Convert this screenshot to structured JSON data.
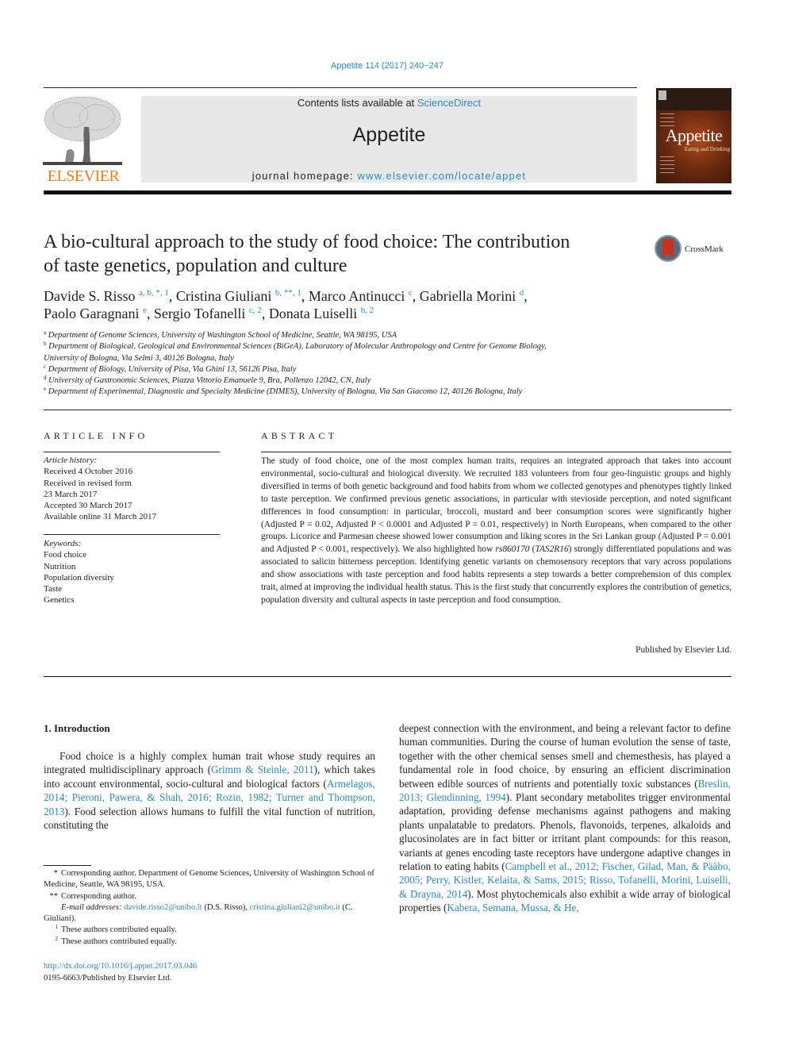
{
  "header": {
    "citation": "Appetite 114 (2017) 240−247",
    "contents_prefix": "Contents lists available at ",
    "contents_link": "ScienceDirect",
    "journal_name": "Appetite",
    "homepage_prefix": "journal homepage: ",
    "homepage_link": "www.elsevier.com/locate/appet",
    "publisher_logo": "ELSEVIER",
    "cover_title": "Appetite",
    "cover_subtitle": "Eating and Drinking",
    "colors": {
      "link": "#2a8ab8",
      "elsevier_orange": "#f07d1a",
      "masthead_gray": "#e8e8e8"
    }
  },
  "article": {
    "title_line1": "A bio-cultural approach to the study of food choice: The contribution",
    "title_line2": "of taste genetics, population and culture",
    "crossmark_label": "CrossMark",
    "authors": [
      {
        "name": "Davide S. Risso",
        "marks": "a, b, *, 1",
        "sep": ", "
      },
      {
        "name": "Cristina Giuliani",
        "marks": "b, **, 1",
        "sep": ", "
      },
      {
        "name": "Marco Antinucci",
        "marks": "c",
        "sep": ", "
      },
      {
        "name": "Gabriella Morini",
        "marks": "d",
        "sep": ","
      },
      {
        "name": "Paolo Garagnani",
        "marks": "e",
        "sep": ", "
      },
      {
        "name": "Sergio Tofanelli",
        "marks": "c, 2",
        "sep": ", "
      },
      {
        "name": "Donata Luiselli",
        "marks": "b, 2",
        "sep": ""
      }
    ],
    "affiliations": [
      {
        "mark": "a",
        "text": "Department of Genome Sciences, University of Washington School of Medicine, Seattle, WA 98195, USA"
      },
      {
        "mark": "b",
        "text": "Department of Biological, Geological and Environmental Sciences (BiGeA), Laboratory of Molecular Anthropology and Centre for Genome Biology,",
        "cont": "University of Bologna, Via Selmi 3, 40126 Bologna, Italy"
      },
      {
        "mark": "c",
        "text": "Department of Biology, University of Pisa, Via Ghini 13, 56126 Pisa, Italy"
      },
      {
        "mark": "d",
        "text": "University of Gastronomic Sciences, Piazza Vittorio Emanuele 9, Bra, Pollenzo 12042, CN, Italy"
      },
      {
        "mark": "e",
        "text": "Department of Experimental, Diagnostic and Specialty Medicine (DIMES), University of Bologna, Via San Giacomo 12, 40126 Bologna, Italy"
      }
    ]
  },
  "article_info": {
    "heading": "ARTICLE INFO",
    "history_label": "Article history:",
    "history": [
      "Received 4 October 2016",
      "Received in revised form",
      "23 March 2017",
      "Accepted 30 March 2017",
      "Available online 31 March 2017"
    ],
    "keywords_label": "Keywords:",
    "keywords": [
      "Food choice",
      "Nutrition",
      "Population diversity",
      "Taste",
      "Genetics"
    ]
  },
  "abstract": {
    "heading": "ABSTRACT",
    "part1": "The study of food choice, one of the most complex human traits, requires an integrated approach that takes into account environmental, socio-cultural and biological diversity. We recruited 183 volunteers from four geo-linguistic groups and highly diversified in terms of both genetic background and food habits from whom we collected genotypes and phenotypes tightly linked to taste perception. We confirmed previous genetic associations, in particular with stevioside perception, and noted significant differences in food consumption: in particular, broccoli, mustard and beer consumption scores were significantly higher (Adjusted P = 0.02, Adjusted P < 0.0001 and Adjusted P = 0.01, respectively) in North Europeans, when compared to the other groups. Licorice and Parmesan cheese showed lower consumption and liking scores in the Sri Lankan group (Adjusted P = 0.001 and Adjusted P < 0.001, respectively). We also highlighted how ",
    "snp": "rs860170",
    "paren_open": " (",
    "gene": "TAS2R16",
    "part2": ") strongly differentiated populations and was associated to salicin bitterness perception. Identifying genetic variants on chemosensory receptors that vary across populations and show associations with taste perception and food habits represents a step towards a better comprehension of this complex trait, aimed at improving the individual health status. This is the first study that concurrently explores the contribution of genetics, population diversity and cultural aspects in taste perception and food consumption.",
    "publisher": "Published by Elsevier Ltd."
  },
  "body": {
    "section_heading": "1.  Introduction",
    "left": [
      {
        "t": "Food choice is a highly complex human trait whose study requires an integrated multidisciplinary approach ("
      },
      {
        "l": "Grimm & Steinle, 2011"
      },
      {
        "t": "), which takes into account environmental, socio-cultural and biological factors ("
      },
      {
        "l": "Armelagos, 2014; Pieroni, Pawera, & Shah, 2016; Rozin, 1982; Turner and Thompson, 2013"
      },
      {
        "t": "). Food selection allows humans to fulfill the vital function of nutrition, constituting the"
      }
    ],
    "right": [
      {
        "t": "deepest connection with the environment, and being a relevant factor to define human communities. During the course of human evolution the sense of taste, together with the other chemical senses smell and chemesthesis, has played a fundamental role in food choice, by ensuring an efficient discrimination between edible sources of nutrients and potentially toxic substances ("
      },
      {
        "l": "Breslin, 2013; Glendinning, 1994"
      },
      {
        "t": "). Plant secondary metabolites trigger environmental adaptation, providing defense mechanisms against pathogens and making plants unpalatable to predators. Phenols, flavonoids, terpenes, alkaloids and glucosinolates are in fact bitter or irritant plant compounds: for this reason, variants at genes encoding taste receptors have undergone adaptive changes in relation to eating habits ("
      },
      {
        "l": "Campbell et al., 2012; Fischer, Gilad, Man, & Pääbo, 2005; Perry, Kistler, Kelaita, & Sams, 2015; Risso, Tofanelli, Morini, Luiselli, & Drayna, 2014"
      },
      {
        "t": "). Most phytochemicals also exhibit a wide array of biological properties ("
      },
      {
        "l": "Kabera, Semana, Mussa, & He,"
      }
    ]
  },
  "footnotes": {
    "fn1_mark": "*",
    "fn1_text": "Corresponding author. Department of Genome Sciences, University of Washington School of Medicine, Seattle, WA 98195, USA.",
    "fn2_mark": "**",
    "fn2_text": "Corresponding author.",
    "email_label": "E-mail addresses:",
    "email1": "davide.risso2@unibo.it",
    "email1_owner": " (D.S. Risso), ",
    "email2": "cristina.giuliani2@unibo.it",
    "email2_owner": " (C. Giuliani).",
    "fn3_mark": "1",
    "fn3_text": "These authors contributed equally.",
    "fn4_mark": "2",
    "fn4_text": "These authors contributed equally.",
    "doi": "http://dx.doi.org/10.1016/j.appet.2017.03.046",
    "issn": "0195-6663/Published by Elsevier Ltd."
  }
}
